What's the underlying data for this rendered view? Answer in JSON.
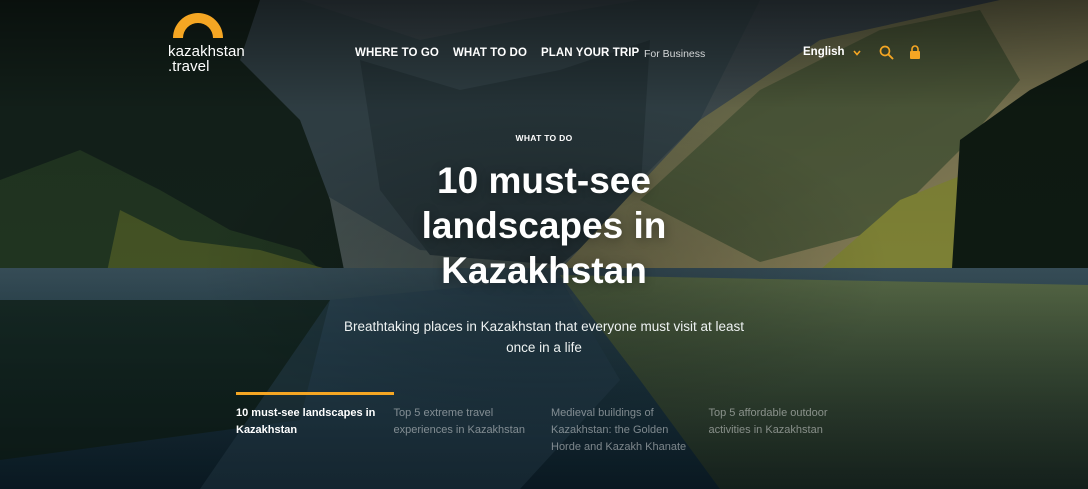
{
  "logo": {
    "line1": "kazakhstan",
    "line2": ".travel"
  },
  "nav": {
    "items": [
      "WHERE TO GO",
      "WHAT TO DO",
      "PLAN YOUR TRIP"
    ],
    "for_business": "For Business",
    "language": "English"
  },
  "hero": {
    "eyebrow": "WHAT TO DO",
    "title": "10 must-see landscapes in Kazakhstan",
    "subtitle": "Breathtaking places in Kazakhstan that everyone must visit at least once in a life"
  },
  "slides": [
    {
      "label": "10 must-see landscapes in Kazakhstan",
      "active": true
    },
    {
      "label": "Top 5 extreme travel experiences in Kazakhstan",
      "active": false
    },
    {
      "label": "Medieval buildings of Kazakhstan: the Golden Horde and Kazakh Khanate",
      "active": false
    },
    {
      "label": "Top 5 affordable outdoor activities in Kazakhstan",
      "active": false
    }
  ],
  "colors": {
    "accent": "#f5a623",
    "text": "#ffffff",
    "muted_text": "#d4d7d8"
  },
  "icons": {
    "search": "search-icon",
    "lock": "lock-icon",
    "language_chevron": "chevron-down-icon",
    "logo_arc": "sun-arc-icon"
  }
}
